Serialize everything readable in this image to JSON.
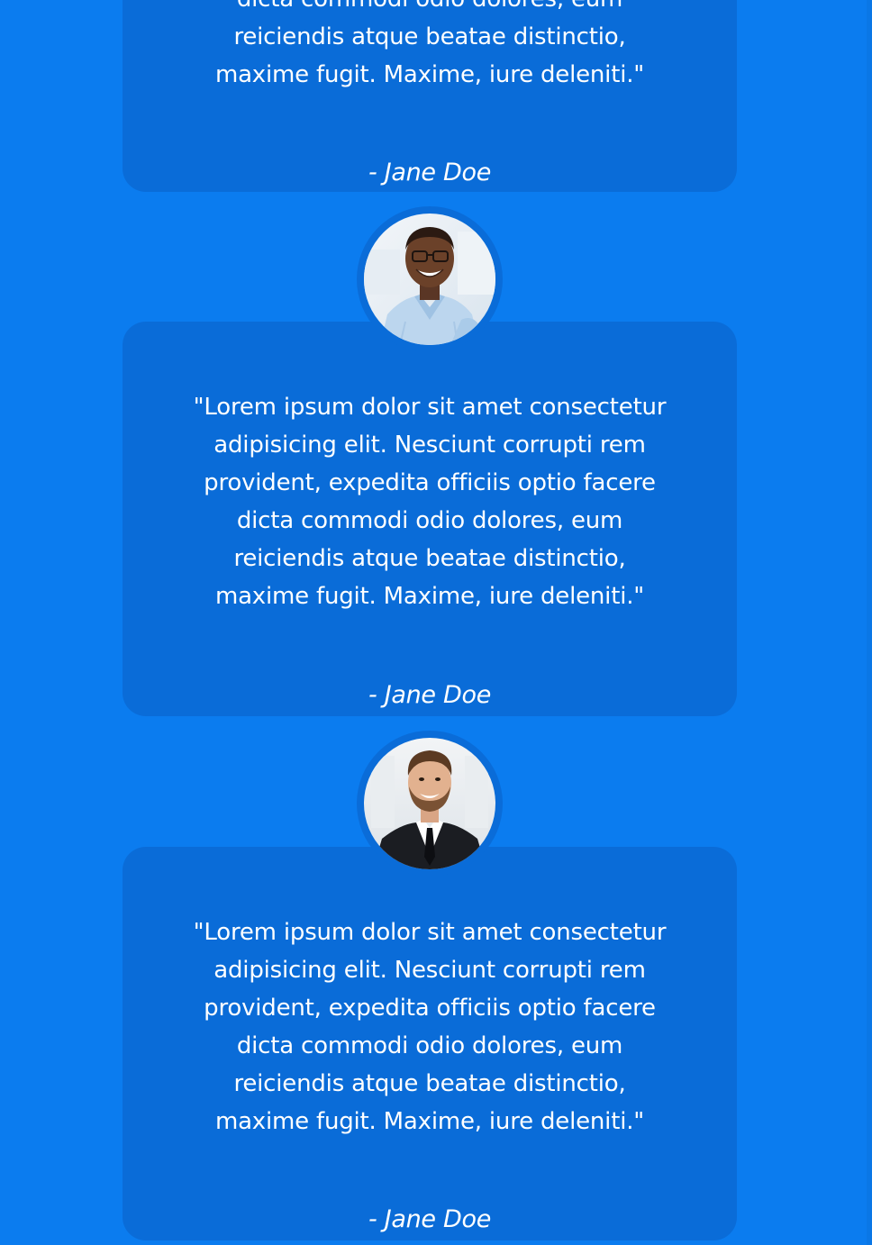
{
  "testimonials": [
    {
      "quote": "\"Lorem ipsum dolor sit amet consectetur adipisicing elit. Nesciunt corrupti rem provident, expedita officiis optio facere dicta commodi odio dolores, eum reiciendis atque beatae distinctio, maxime fugit. Maxime, iure deleniti.\"",
      "author": "- Jane Doe"
    },
    {
      "quote": "\"Lorem ipsum dolor sit amet consectetur adipisicing elit. Nesciunt corrupti rem provident, expedita officiis optio facere dicta commodi odio dolores, eum reiciendis atque beatae distinctio, maxime fugit. Maxime, iure deleniti.\"",
      "author": "- Jane Doe",
      "avatar": "smiling-man-glasses-photo"
    },
    {
      "quote": "\"Lorem ipsum dolor sit amet consectetur adipisicing elit. Nesciunt corrupti rem provident, expedita officiis optio facere dicta commodi odio dolores, eum reiciendis atque beatae distinctio, maxime fugit. Maxime, iure deleniti.\"",
      "author": "- Jane Doe",
      "avatar": "businessman-suit-photo"
    }
  ],
  "colors": {
    "page_background": "#0b7cef",
    "card_background": "#0a6cd8",
    "text": "#ffffff"
  }
}
